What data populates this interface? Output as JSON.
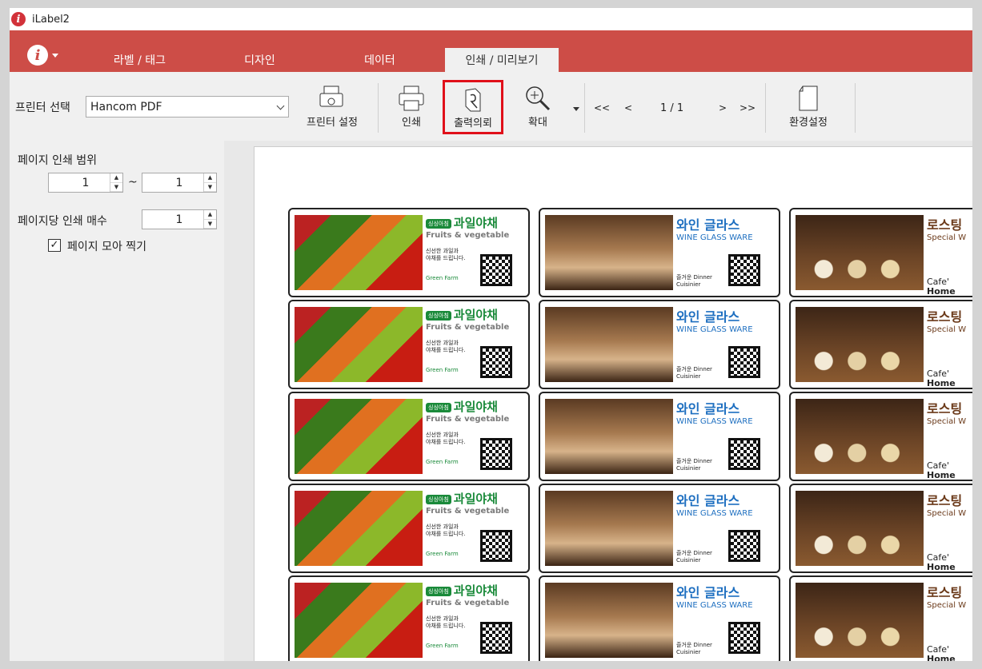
{
  "app": {
    "title": "iLabel2",
    "logo_letter": "i"
  },
  "tabs": [
    {
      "label": "라벨 / 태그"
    },
    {
      "label": "디자인"
    },
    {
      "label": "데이터"
    },
    {
      "label": "인쇄 / 미리보기"
    }
  ],
  "active_tab": "인쇄 / 미리보기",
  "toolbar": {
    "printer_label": "프린터 선택",
    "printer_value": "Hancom PDF",
    "printer_setup": "프린터 설정",
    "print": "인쇄",
    "output_request": "출력의뢰",
    "zoom": "확대",
    "nav_first": "<<",
    "nav_prev": "<",
    "page_indicator": "1 / 1",
    "nav_next": ">",
    "nav_last": ">>",
    "settings": "환경설정"
  },
  "left_panel": {
    "print_range_label": "페이지 인쇄 범위",
    "range_from": "1",
    "range_sep": "~",
    "range_to": "1",
    "copies_label": "페이지당 인쇄 매수",
    "copies_value": "1",
    "collate_label": "페이지 모아 찍기",
    "collate_checked": "☑"
  },
  "labels": {
    "fruit": {
      "badge": "싱싱아침",
      "title": "과일야채",
      "subtitle": "Fruits & vegetable",
      "line1": "신선한 과일과",
      "line2": "야채를 드립니다.",
      "brand": "Green Farm"
    },
    "wine": {
      "title": "와인 글라스",
      "subtitle": "WINE GLASS WARE",
      "line1": "즐거운 Dinner",
      "line2": "Cuisinier"
    },
    "cafe": {
      "title": "로스팅",
      "subtitle": "Special W",
      "line1": "Cafe'",
      "line2": "Home"
    }
  },
  "colors": {
    "ribbon": "#cd4d47",
    "highlight": "#e0101a",
    "fruit_green": "#1a8a3a",
    "wine_blue": "#1e6fc0",
    "cafe_brown": "#6b3a1a"
  }
}
